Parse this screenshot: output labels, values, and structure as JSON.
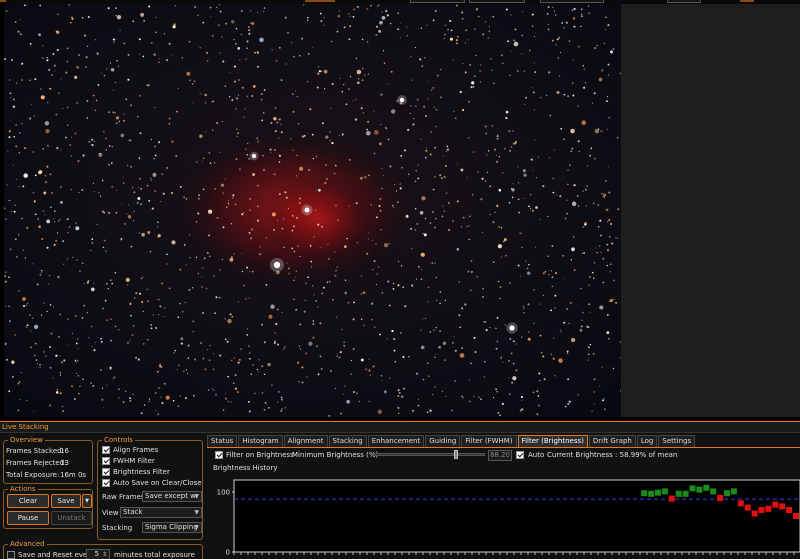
{
  "panel_title": "Live Stacking",
  "overview": {
    "title": "Overview",
    "rows": [
      {
        "label": "Frames Stacked:",
        "value": "16"
      },
      {
        "label": "Frames Rejected:",
        "value": "13"
      },
      {
        "label": "Total Exposure:",
        "value": "16m 0s"
      }
    ]
  },
  "actions": {
    "title": "Actions",
    "clear": "Clear",
    "save": "Save",
    "pause": "Pause",
    "unstack": "Unstack"
  },
  "advanced": {
    "title": "Advanced",
    "save_reset_label": "Save and Reset every",
    "save_reset_value": "5",
    "save_reset_suffix": "minutes total exposure",
    "checked": false
  },
  "controls": {
    "title": "Controls",
    "checks": [
      {
        "label": "Align Frames",
        "checked": true
      },
      {
        "label": "FWHM Filter",
        "checked": true
      },
      {
        "label": "Brightness Filter",
        "checked": true
      },
      {
        "label": "Auto Save on Clear/Close",
        "checked": true
      }
    ],
    "raw_frames_label": "Raw Frames",
    "raw_frames_value": "Save except w",
    "view_label": "View",
    "view_value": "Stack",
    "stacking_label": "Stacking",
    "stacking_value": "Sigma Clipping"
  },
  "tabs": [
    "Status",
    "Histogram",
    "Alignment",
    "Stacking",
    "Enhancement",
    "Guiding",
    "Filter (FWHM)",
    "Filter (Brightness)",
    "Drift Graph",
    "Log",
    "Settings"
  ],
  "active_tab": "Filter (Brightness)",
  "brightness": {
    "filter_label": "Filter on Brightness",
    "min_label": "Minimum Brightness (%)",
    "min_value": "88.20",
    "auto_label": "Auto",
    "current_label": "Current Brightness : 58.99% of mean",
    "history_title": "Brightness History"
  },
  "chart_data": {
    "type": "scatter",
    "title": "Brightness History",
    "ylim": [
      0,
      120
    ],
    "y_ticks": [
      "100",
      "0"
    ],
    "threshold": 88.2,
    "colors": {
      "accepted": "#1a8a1a",
      "rejected": "#e01010",
      "threshold": "#3a3aff"
    },
    "points": [
      {
        "x": 1,
        "y": 98,
        "accepted": true
      },
      {
        "x": 2,
        "y": 97,
        "accepted": true
      },
      {
        "x": 3,
        "y": 99,
        "accepted": true
      },
      {
        "x": 4,
        "y": 101,
        "accepted": true
      },
      {
        "x": 5,
        "y": 89,
        "accepted": false
      },
      {
        "x": 6,
        "y": 97,
        "accepted": true
      },
      {
        "x": 7,
        "y": 97,
        "accepted": true
      },
      {
        "x": 8,
        "y": 106,
        "accepted": true
      },
      {
        "x": 9,
        "y": 104,
        "accepted": true
      },
      {
        "x": 10,
        "y": 107,
        "accepted": true
      },
      {
        "x": 11,
        "y": 101,
        "accepted": true
      },
      {
        "x": 12,
        "y": 90,
        "accepted": false
      },
      {
        "x": 13,
        "y": 98,
        "accepted": true
      },
      {
        "x": 14,
        "y": 101,
        "accepted": true
      },
      {
        "x": 15,
        "y": 81,
        "accepted": false
      },
      {
        "x": 16,
        "y": 74,
        "accepted": false
      },
      {
        "x": 17,
        "y": 64,
        "accepted": false
      },
      {
        "x": 18,
        "y": 70,
        "accepted": false
      },
      {
        "x": 19,
        "y": 72,
        "accepted": false
      },
      {
        "x": 20,
        "y": 79,
        "accepted": false
      },
      {
        "x": 21,
        "y": 76,
        "accepted": false
      },
      {
        "x": 22,
        "y": 70,
        "accepted": false
      },
      {
        "x": 23,
        "y": 60,
        "accepted": false
      }
    ],
    "x_count": 23
  }
}
